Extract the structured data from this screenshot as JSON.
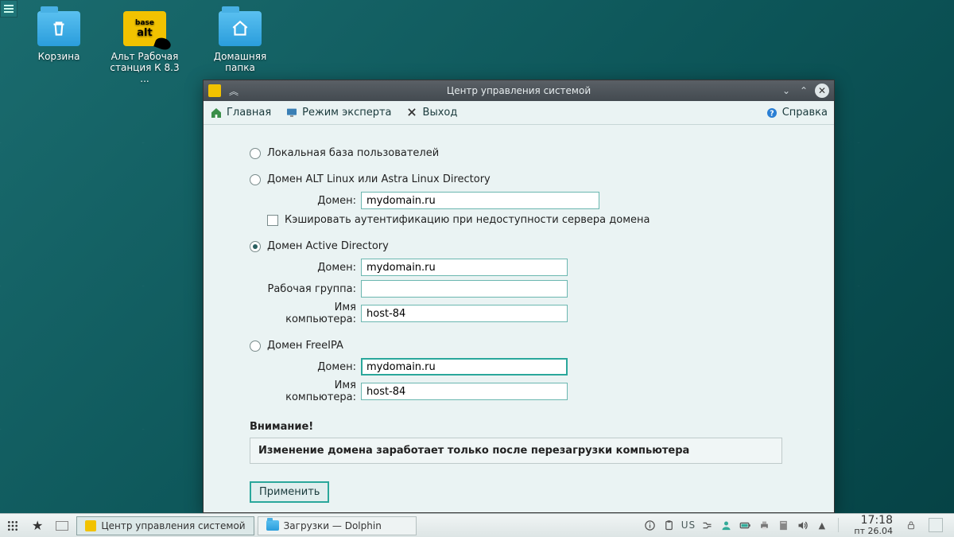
{
  "desktop": {
    "trash": "Корзина",
    "alt": "Альт Рабочая станция К 8.3  ...",
    "home": "Домашняя папка"
  },
  "window": {
    "title": "Центр управления системой",
    "toolbar": {
      "main": "Главная",
      "expert": "Режим эксперта",
      "exit": "Выход",
      "help": "Справка"
    },
    "options": {
      "local": "Локальная база пользователей",
      "altlinux": {
        "label": "Домен ALT Linux или Astra Linux Directory",
        "domain_label": "Домен:",
        "domain_value": "mydomain.ru",
        "cache": "Кэшировать аутентификацию при недоступности сервера домена"
      },
      "ad": {
        "label": "Домен Active Directory",
        "domain_label": "Домен:",
        "domain_value": "mydomain.ru",
        "workgroup_label": "Рабочая группа:",
        "workgroup_value": "",
        "hostname_label": "Имя компьютера:",
        "hostname_value": "host-84"
      },
      "freeipa": {
        "label": "Домен FreeIPA",
        "domain_label": "Домен:",
        "domain_value": "mydomain.ru",
        "hostname_label": "Имя компьютера:",
        "hostname_value": "host-84"
      }
    },
    "warning_label": "Внимание!",
    "warning_text": "Изменение домена заработает только после перезагрузки компьютера",
    "apply": "Применить"
  },
  "taskbar": {
    "task1": "Центр управления системой",
    "task2": "Загрузки — Dolphin",
    "kbd": "US",
    "time": "17:18",
    "date": "пт 26.04"
  }
}
